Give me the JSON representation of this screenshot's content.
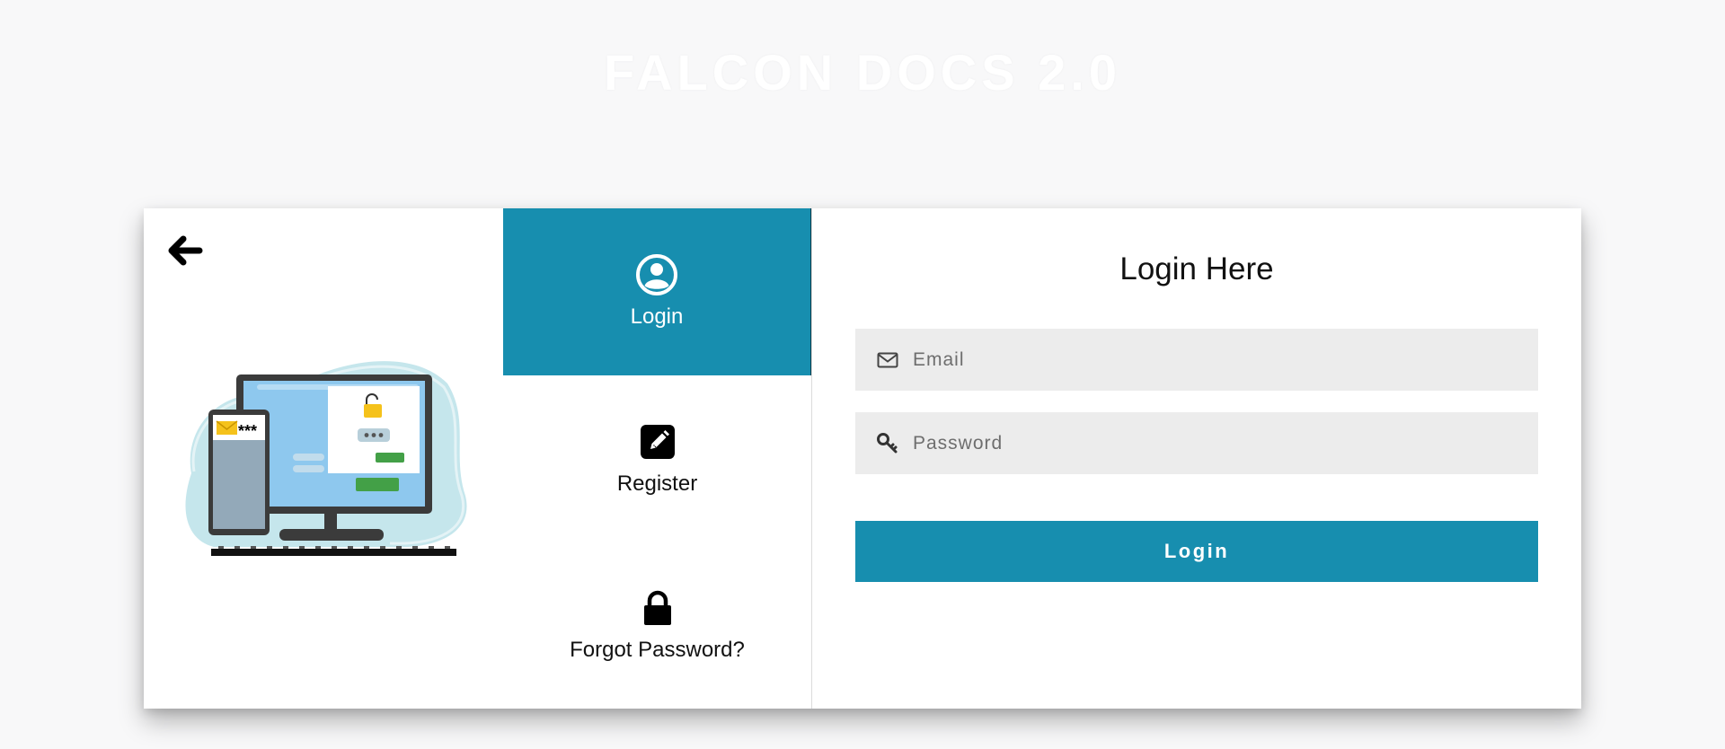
{
  "app": {
    "title": "FALCON DOCS 2.0"
  },
  "nav": {
    "items": [
      {
        "label": "Login",
        "icon": "user-circle-icon",
        "active": true
      },
      {
        "label": "Register",
        "icon": "pencil-square-icon",
        "active": false
      },
      {
        "label": "Forgot Password?",
        "icon": "lock-icon",
        "active": false
      }
    ]
  },
  "form": {
    "title": "Login Here",
    "email": {
      "placeholder": "Email",
      "value": "",
      "icon": "envelope-icon"
    },
    "password": {
      "placeholder": "Password",
      "value": "",
      "icon": "key-icon"
    },
    "submit_label": "Login"
  },
  "illustration": {
    "badge_text": "***"
  },
  "colors": {
    "accent": "#178eaf",
    "background": "#f8f8f9",
    "field": "#ececec"
  }
}
